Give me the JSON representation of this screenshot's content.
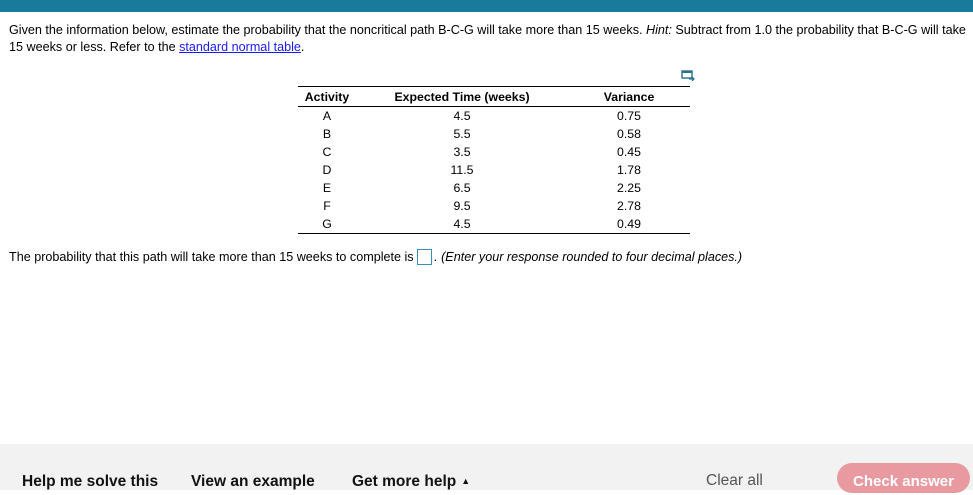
{
  "question": {
    "text_before_hint": "Given the information below, estimate the probability that the noncritical path B-C-G will take more than 15 weeks.",
    "hint_label": "Hint:",
    "hint_text": "Subtract from 1.0 the probability that B-C-G will take 15 weeks or less. Refer to the",
    "link_text": "standard normal table",
    "end_punct": "."
  },
  "table": {
    "headers": [
      "Activity",
      "Expected Time (weeks)",
      "Variance"
    ],
    "rows": [
      [
        "A",
        "4.5",
        "0.75"
      ],
      [
        "B",
        "5.5",
        "0.58"
      ],
      [
        "C",
        "3.5",
        "0.45"
      ],
      [
        "D",
        "11.5",
        "1.78"
      ],
      [
        "E",
        "6.5",
        "2.25"
      ],
      [
        "F",
        "9.5",
        "2.78"
      ],
      [
        "G",
        "4.5",
        "0.49"
      ]
    ]
  },
  "answer": {
    "prompt": "The probability that this path will take more than 15 weeks to complete is",
    "value": "",
    "after_box": ".",
    "instruction": "(Enter your response rounded to four decimal places.)"
  },
  "footer": {
    "help_label": "Help me solve this",
    "example_label": "View an example",
    "more_help_label": "Get more help",
    "clear_label": "Clear all",
    "check_label": "Check answer"
  },
  "colors": {
    "top_bar": "#1a7a9c",
    "link": "#1a1aff",
    "answer_box_border": "#3b8fb3",
    "check_button": "#e89aa0",
    "footer_bg": "#f2f2f2"
  },
  "icons": {
    "popout": "popout-icon",
    "more_help_caret": "caret-up-icon"
  }
}
